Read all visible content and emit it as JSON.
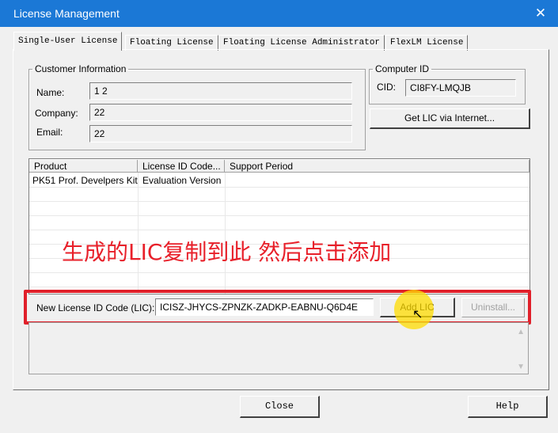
{
  "window": {
    "title": "License Management",
    "close_glyph": "✕"
  },
  "tabs": [
    {
      "label": "Single-User License",
      "active": true
    },
    {
      "label": "Floating License",
      "active": false
    },
    {
      "label": "Floating License Administrator",
      "active": false
    },
    {
      "label": "FlexLM License",
      "active": false
    }
  ],
  "customer": {
    "legend": "Customer Information",
    "name_label": "Name:",
    "name_value": "1 2",
    "company_label": "Company:",
    "company_value": "22",
    "email_label": "Email:",
    "email_value": "22"
  },
  "computer": {
    "legend": "Computer ID",
    "cid_label": "CID:",
    "cid_value": "CI8FY-LMQJB",
    "get_lic_label": "Get LIC via Internet..."
  },
  "list": {
    "columns": [
      "Product",
      "License ID Code...",
      "Support Period"
    ],
    "rows": [
      {
        "product": "PK51 Prof. Develpers Kit",
        "license": "Evaluation Version",
        "support": ""
      }
    ]
  },
  "annotation_text": "生成的LIC复制到此 然后点击添加",
  "new_license": {
    "label": "New License ID Code (LIC):",
    "value": "ICISZ-JHYCS-ZPNZK-ZADKP-EABNU-Q6D4E",
    "add_label": "Add LIC",
    "uninstall_label": "Uninstall..."
  },
  "footer": {
    "close_label": "Close",
    "help_label": "Help"
  },
  "colors": {
    "titlebar": "#1b78d6",
    "highlight": "#e0202a",
    "annotation": "#e8202a",
    "cursor_highlight": "#ffdc00"
  },
  "icons": {
    "close": "close-icon",
    "scroll_up": "scroll-up-icon",
    "scroll_down": "scroll-down-icon",
    "pointer": "mouse-pointer-icon"
  }
}
